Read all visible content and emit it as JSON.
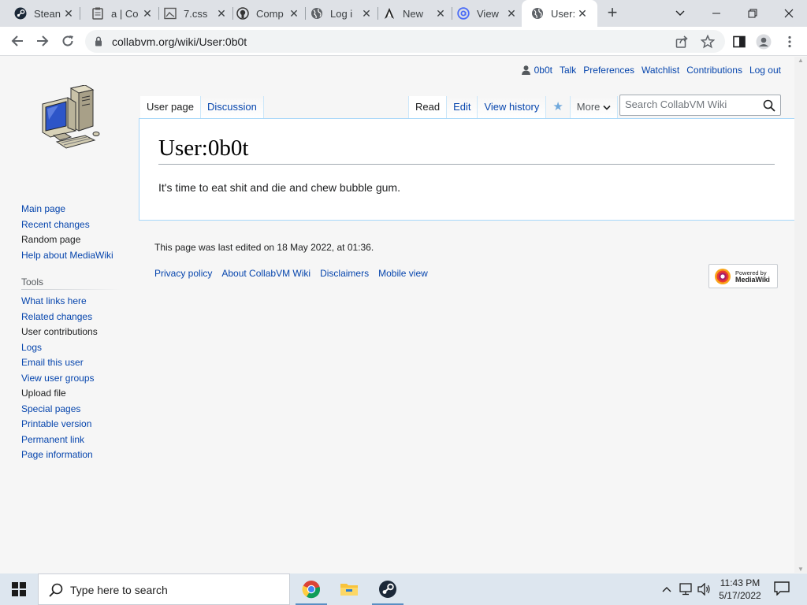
{
  "browser": {
    "tabs": [
      {
        "title": "Stean",
        "icon": "steam-icon"
      },
      {
        "title": "a | Co",
        "icon": "clipboard-icon"
      },
      {
        "title": "7.css",
        "icon": "image-icon"
      },
      {
        "title": "Comp",
        "icon": "github-icon"
      },
      {
        "title": "Log i",
        "icon": "globe-icon"
      },
      {
        "title": "New",
        "icon": "app-icon"
      },
      {
        "title": "View",
        "icon": "at-icon"
      },
      {
        "title": "User:",
        "icon": "globe-icon"
      }
    ],
    "url": "collabvm.org/wiki/User:0b0t"
  },
  "wiki": {
    "user_tools": {
      "username": "0b0t",
      "talk": "Talk",
      "preferences": "Preferences",
      "watchlist": "Watchlist",
      "contributions": "Contributions",
      "logout": "Log out"
    },
    "namespace_tabs": {
      "user_page": "User page",
      "discussion": "Discussion"
    },
    "view_tabs": {
      "read": "Read",
      "edit": "Edit",
      "history": "View history",
      "more": "More"
    },
    "search_placeholder": "Search CollabVM Wiki",
    "title": "User:0b0t",
    "body": "It's time to eat shit and die and chew bubble gum.",
    "navigation": [
      "Main page",
      "Recent changes",
      "Random page",
      "Help about MediaWiki"
    ],
    "tools_heading": "Tools",
    "tools": [
      "What links here",
      "Related changes",
      "User contributions",
      "Logs",
      "Email this user",
      "View user groups",
      "Upload file",
      "Special pages",
      "Printable version",
      "Permanent link",
      "Page information"
    ],
    "footer": {
      "last_edited": "This page was last edited on 18 May 2022, at 01:36.",
      "links": [
        "Privacy policy",
        "About CollabVM Wiki",
        "Disclaimers",
        "Mobile view"
      ],
      "powered_by": "Powered by",
      "powered_name": "MediaWiki"
    }
  },
  "taskbar": {
    "search_text": "Type here to search",
    "time": "11:43 PM",
    "date": "5/17/2022"
  }
}
